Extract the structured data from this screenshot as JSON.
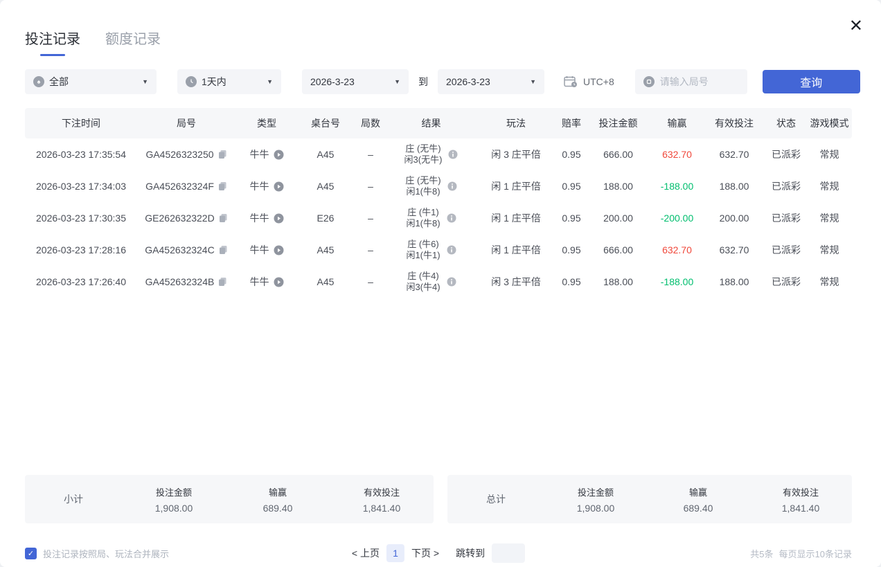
{
  "window": {
    "close_glyph": "✕"
  },
  "tabs": [
    {
      "label": "投注记录",
      "active": true
    },
    {
      "label": "额度记录",
      "active": false
    }
  ],
  "filters": {
    "type_select_value": "全部",
    "time_select_value": "1天内",
    "date_from": "2026-3-23",
    "to_label": "到",
    "date_to": "2026-3-23",
    "timezone_label": "UTC+8",
    "round_placeholder": "请输入局号",
    "query_button_label": "查询",
    "caret_glyph": "▼"
  },
  "table": {
    "headers": [
      "下注时间",
      "局号",
      "类型",
      "桌台号",
      "局数",
      "结果",
      "玩法",
      "赔率",
      "投注金额",
      "输赢",
      "有效投注",
      "状态",
      "游戏模式"
    ],
    "rows": [
      {
        "time": "2026-03-23 17:35:54",
        "round_id": "GA4526323250",
        "type": "牛牛",
        "table_no": "A45",
        "rounds": "–",
        "result_line1": "庄 (无牛)",
        "result_line2": "闲3(无牛)",
        "play": "闲 3 庄平倍",
        "odds": "0.95",
        "bet": "666.00",
        "winloss": "632.70",
        "valid": "632.70",
        "status": "已派彩",
        "mode": "常规"
      },
      {
        "time": "2026-03-23 17:34:03",
        "round_id": "GA452632324F",
        "type": "牛牛",
        "table_no": "A45",
        "rounds": "–",
        "result_line1": "庄 (无牛)",
        "result_line2": "闲1(牛8)",
        "play": "闲 1 庄平倍",
        "odds": "0.95",
        "bet": "188.00",
        "winloss": "-188.00",
        "valid": "188.00",
        "status": "已派彩",
        "mode": "常规"
      },
      {
        "time": "2026-03-23 17:30:35",
        "round_id": "GE262632322D",
        "type": "牛牛",
        "table_no": "E26",
        "rounds": "–",
        "result_line1": "庄 (牛1)",
        "result_line2": "闲1(牛8)",
        "play": "闲 1 庄平倍",
        "odds": "0.95",
        "bet": "200.00",
        "winloss": "-200.00",
        "valid": "200.00",
        "status": "已派彩",
        "mode": "常规"
      },
      {
        "time": "2026-03-23 17:28:16",
        "round_id": "GA452632324C",
        "type": "牛牛",
        "table_no": "A45",
        "rounds": "–",
        "result_line1": "庄 (牛6)",
        "result_line2": "闲1(牛1)",
        "play": "闲 1 庄平倍",
        "odds": "0.95",
        "bet": "666.00",
        "winloss": "632.70",
        "valid": "632.70",
        "status": "已派彩",
        "mode": "常规"
      },
      {
        "time": "2026-03-23 17:26:40",
        "round_id": "GA452632324B",
        "type": "牛牛",
        "table_no": "A45",
        "rounds": "–",
        "result_line1": "庄 (牛4)",
        "result_line2": "闲3(牛4)",
        "play": "闲 3 庄平倍",
        "odds": "0.95",
        "bet": "188.00",
        "winloss": "-188.00",
        "valid": "188.00",
        "status": "已派彩",
        "mode": "常规"
      }
    ]
  },
  "summary": {
    "subtotal": {
      "label": "小计",
      "bet_label": "投注金额",
      "bet": "1,908.00",
      "win_label": "输赢",
      "win": "689.40",
      "valid_label": "有效投注",
      "valid": "1,841.40"
    },
    "total": {
      "label": "总计",
      "bet_label": "投注金额",
      "bet": "1,908.00",
      "win_label": "输赢",
      "win": "689.40",
      "valid_label": "有效投注",
      "valid": "1,841.40"
    }
  },
  "footer": {
    "merge_label": "投注记录按照局、玩法合并展示",
    "checkbox_checked_glyph": "✓",
    "pagination": {
      "prev": "< 上页",
      "current_page": "1",
      "next": "下页 >",
      "jump_label": "跳转到"
    },
    "total_records": "共5条",
    "per_page_info": "每页显示10条记录"
  },
  "colors": {
    "accent_blue": "#4366d6",
    "win_red": "#f0483b",
    "loss_green": "#00be6e",
    "header_bg": "#f6f7f9"
  }
}
